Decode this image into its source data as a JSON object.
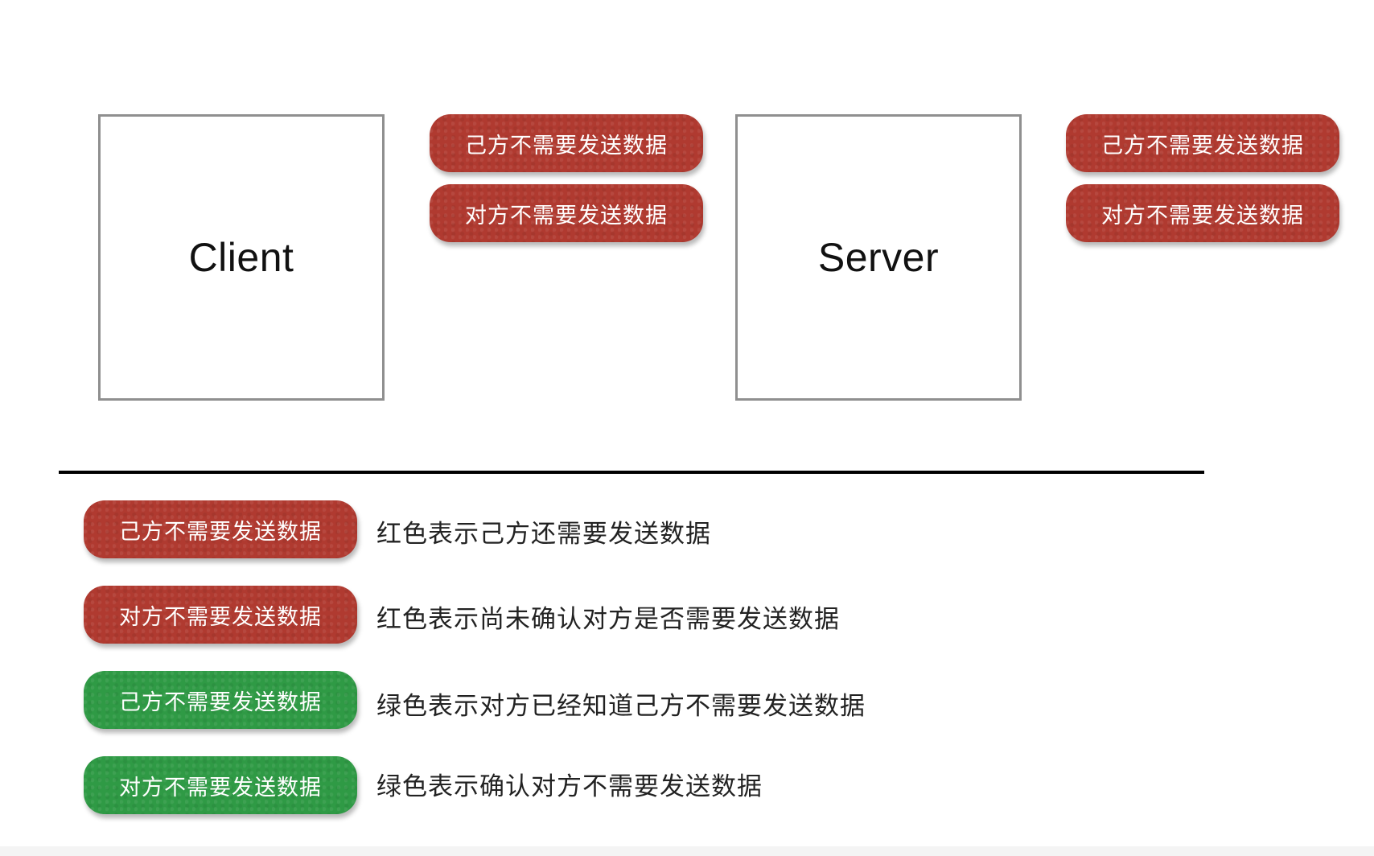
{
  "nodes": {
    "client": {
      "label": "Client"
    },
    "server": {
      "label": "Server"
    }
  },
  "client_states": {
    "self_label": "己方不需要发送数据",
    "self_state": "red",
    "peer_label": "对方不需要发送数据",
    "peer_state": "red"
  },
  "server_states": {
    "self_label": "己方不需要发送数据",
    "self_state": "red",
    "peer_label": "对方不需要发送数据",
    "peer_state": "red"
  },
  "legend": [
    {
      "pill_label": "己方不需要发送数据",
      "color": "red",
      "description": "红色表示己方还需要发送数据"
    },
    {
      "pill_label": "对方不需要发送数据",
      "color": "red",
      "description": "红色表示尚未确认对方是否需要发送数据"
    },
    {
      "pill_label": "己方不需要发送数据",
      "color": "green",
      "description": "绿色表示对方已经知道己方不需要发送数据"
    },
    {
      "pill_label": "对方不需要发送数据",
      "color": "green",
      "description": "绿色表示确认对方不需要发送数据"
    }
  ],
  "colors": {
    "red": "#b03a30",
    "green": "#2f9a45",
    "box_border": "#8f8f8f",
    "divider": "#000000"
  }
}
